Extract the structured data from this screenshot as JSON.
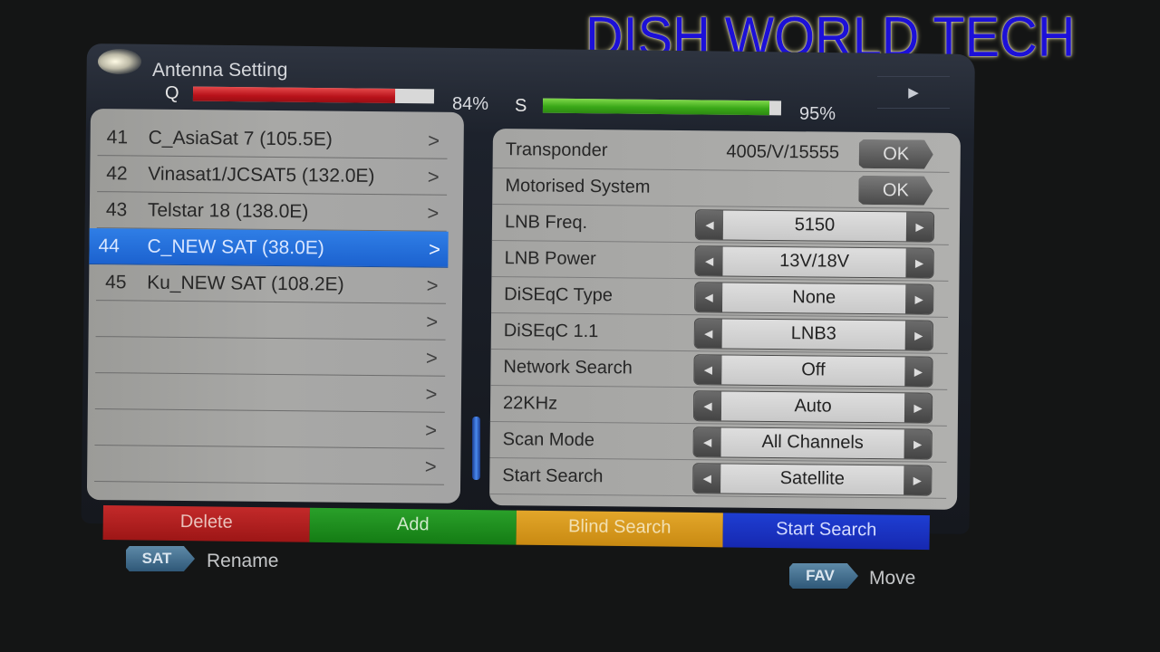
{
  "watermark": "DISH WORLD TECH",
  "header": {
    "title": "Antenna Setting",
    "quality": {
      "label": "Q",
      "percent": 84,
      "display": "84%"
    },
    "strength": {
      "label": "S",
      "percent": 95,
      "display": "95%"
    },
    "next_icon": "play-right-icon",
    "next_glyph": "▶"
  },
  "satellite_list": {
    "selected_index": 3,
    "chevron": ">",
    "items": [
      {
        "num": "41",
        "name": "C_AsiaSat 7 (105.5E)"
      },
      {
        "num": "42",
        "name": "Vinasat1/JCSAT5 (132.0E)"
      },
      {
        "num": "43",
        "name": "Telstar 18  (138.0E)"
      },
      {
        "num": "44",
        "name": "C_NEW SAT (38.0E)"
      },
      {
        "num": "45",
        "name": "Ku_NEW SAT (108.2E)"
      },
      {
        "num": "",
        "name": ""
      },
      {
        "num": "",
        "name": ""
      },
      {
        "num": "",
        "name": ""
      },
      {
        "num": "",
        "name": ""
      },
      {
        "num": "",
        "name": ""
      }
    ]
  },
  "settings": {
    "arrow_left": "◀",
    "arrow_right": "▶",
    "ok_label": "OK",
    "transponder": {
      "label": "Transponder",
      "value": "4005/V/15555"
    },
    "motorised": {
      "label": "Motorised System"
    },
    "rows": [
      {
        "label": "LNB Freq.",
        "value": "5150"
      },
      {
        "label": "LNB Power",
        "value": "13V/18V"
      },
      {
        "label": "DiSEqC Type",
        "value": "None"
      },
      {
        "label": "DiSEqC 1.1",
        "value": "LNB3"
      },
      {
        "label": "Network Search",
        "value": "Off"
      },
      {
        "label": "22KHz",
        "value": "Auto"
      },
      {
        "label": "Scan Mode",
        "value": "All Channels"
      },
      {
        "label": "Start Search",
        "value": "Satellite"
      }
    ]
  },
  "color_keys": {
    "red": "Delete",
    "green": "Add",
    "yellow": "Blind Search",
    "blue": "Start Search"
  },
  "hints": {
    "sat": {
      "key": "SAT",
      "action": "Rename"
    },
    "fav": {
      "key": "FAV",
      "action": "Move"
    }
  },
  "colors": {
    "selection": "#1c62cf",
    "quality_bar": "#b8121a",
    "strength_bar": "#3aa818",
    "watermark": "#1c10d8"
  }
}
